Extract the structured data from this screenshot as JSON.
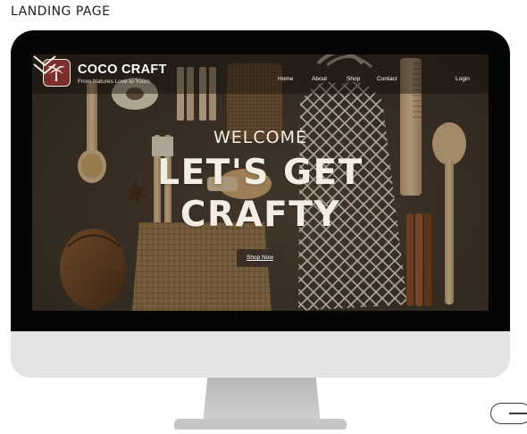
{
  "caption": "LANDING PAGE",
  "nav": {
    "brand": "COCO CRAFT",
    "tagline": "From Natures Love to Yours",
    "links": [
      "Home",
      "About",
      "Shop",
      "Contact"
    ],
    "login": "Login"
  },
  "hero": {
    "welcome": "WELCOME",
    "headline_line1": "LET'S GET",
    "headline_line2": "CRAFTY",
    "cta": "Shop Now"
  },
  "colors": {
    "logo_bg": "#7a2e2e",
    "screen_bg": "#3e3228",
    "button_bg": "#3b2f25",
    "monitor_frame": "#050505",
    "monitor_chin": "#e4e4e4"
  },
  "icons": {
    "logo": "palm-tree-icon",
    "scroll": "double-chevron-down-icon"
  }
}
